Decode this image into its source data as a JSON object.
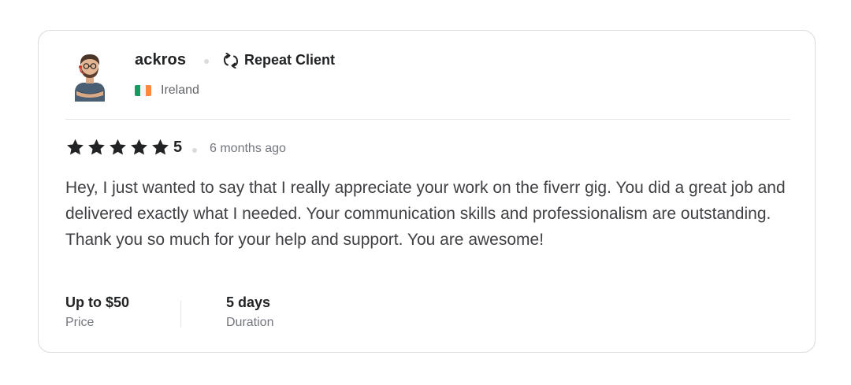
{
  "review": {
    "username": "ackros",
    "badge": {
      "label": "Repeat Client",
      "icon": "repeat-icon"
    },
    "country": {
      "name": "Ireland",
      "flag_colors": [
        "#169b62",
        "#ffffff",
        "#ff883e"
      ]
    },
    "rating": {
      "value": "5",
      "stars": 5,
      "star_color": "#222325"
    },
    "time_ago": "6 months ago",
    "text": "Hey, I just wanted to say that I really appreciate your work on the fiverr gig. You did a great job and delivered exactly what I needed. Your communication skills and professionalism are outstanding. Thank you so much for your help and support. You are awesome!",
    "price": {
      "value": "Up to $50",
      "label": "Price"
    },
    "duration": {
      "value": "5 days",
      "label": "Duration"
    }
  }
}
